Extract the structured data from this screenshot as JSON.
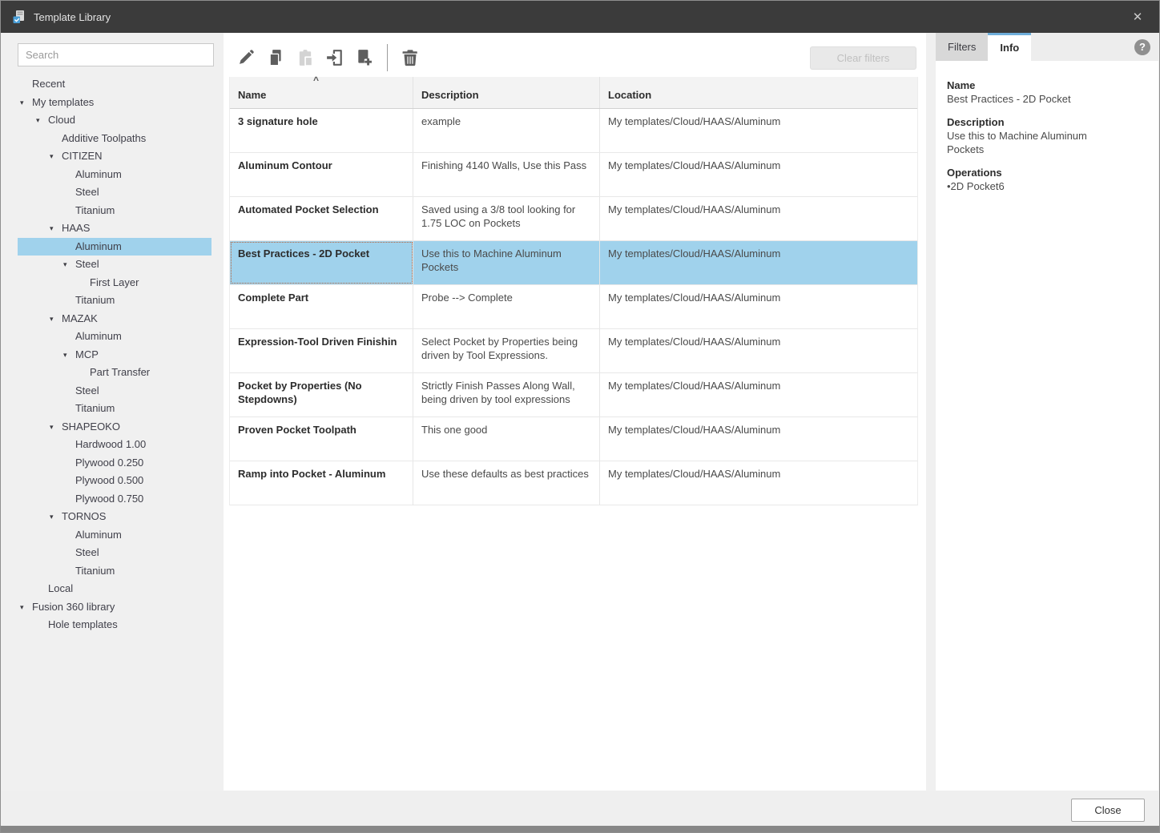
{
  "window": {
    "title": "Template Library"
  },
  "glyphs": {
    "close": "✕",
    "tree_expanded": "▾",
    "sort_asc": "^",
    "help": "?"
  },
  "colors": {
    "titlebar": "#3b3b3b",
    "selection": "#a0d2ec",
    "tab_accent": "#6faedb",
    "focus_dotted": "#b4653f"
  },
  "sidebar": {
    "search_placeholder": "Search",
    "tree": [
      {
        "label": "Recent",
        "level": 0
      },
      {
        "label": "My templates",
        "level": 0,
        "expanded": true
      },
      {
        "label": "Cloud",
        "level": 1,
        "expanded": true
      },
      {
        "label": "Additive Toolpaths",
        "level": 2
      },
      {
        "label": "CITIZEN",
        "level": 2,
        "expanded": true
      },
      {
        "label": "Aluminum",
        "level": 3
      },
      {
        "label": "Steel",
        "level": 3
      },
      {
        "label": "Titanium",
        "level": 3
      },
      {
        "label": "HAAS",
        "level": 2,
        "expanded": true
      },
      {
        "label": "Aluminum",
        "level": 3,
        "selected": true
      },
      {
        "label": "Steel",
        "level": 3,
        "expanded": true
      },
      {
        "label": "First Layer",
        "level": 4
      },
      {
        "label": "Titanium",
        "level": 3
      },
      {
        "label": "MAZAK",
        "level": 2,
        "expanded": true
      },
      {
        "label": "Aluminum",
        "level": 3
      },
      {
        "label": "MCP",
        "level": 3,
        "expanded": true
      },
      {
        "label": "Part Transfer",
        "level": 4
      },
      {
        "label": "Steel",
        "level": 3
      },
      {
        "label": "Titanium",
        "level": 3
      },
      {
        "label": "SHAPEOKO",
        "level": 2,
        "expanded": true
      },
      {
        "label": "Hardwood 1.00",
        "level": 3
      },
      {
        "label": "Plywood 0.250",
        "level": 3
      },
      {
        "label": "Plywood 0.500",
        "level": 3
      },
      {
        "label": "Plywood 0.750",
        "level": 3
      },
      {
        "label": "TORNOS",
        "level": 2,
        "expanded": true
      },
      {
        "label": "Aluminum",
        "level": 3
      },
      {
        "label": "Steel",
        "level": 3
      },
      {
        "label": "Titanium",
        "level": 3
      },
      {
        "label": "Local",
        "level": 1
      },
      {
        "label": "Fusion 360 library",
        "level": 0,
        "expanded": true
      },
      {
        "label": "Hole templates",
        "level": 1
      }
    ]
  },
  "toolbar": {
    "icons": [
      {
        "name": "edit",
        "disabled": false
      },
      {
        "name": "copy",
        "disabled": false
      },
      {
        "name": "paste",
        "disabled": true
      },
      {
        "name": "import",
        "disabled": false
      },
      {
        "name": "export",
        "disabled": false
      },
      {
        "name": "separator"
      },
      {
        "name": "delete",
        "disabled": false
      }
    ],
    "clear_filters_label": "Clear filters"
  },
  "table": {
    "columns": [
      "Name",
      "Description",
      "Location"
    ],
    "rows": [
      {
        "name": "3 signature hole",
        "description": "example",
        "location": "My templates/Cloud/HAAS/Aluminum"
      },
      {
        "name": "Aluminum Contour",
        "description": "Finishing 4140 Walls, Use this Pass",
        "location": "My templates/Cloud/HAAS/Aluminum"
      },
      {
        "name": "Automated Pocket Selection",
        "description": "Saved using a 3/8 tool looking for 1.75 LOC on Pockets",
        "location": "My templates/Cloud/HAAS/Aluminum"
      },
      {
        "name": "Best Practices - 2D Pocket",
        "description": "Use this to Machine Aluminum Pockets",
        "location": "My templates/Cloud/HAAS/Aluminum",
        "selected": true
      },
      {
        "name": "Complete Part",
        "description": "Probe --> Complete",
        "location": "My templates/Cloud/HAAS/Aluminum"
      },
      {
        "name": "Expression-Tool Driven Finishin",
        "description": "Select Pocket by Properties being driven by Tool Expressions.",
        "location": "My templates/Cloud/HAAS/Aluminum"
      },
      {
        "name": "Pocket by Properties (No Stepdowns)",
        "description": "Strictly Finish Passes Along Wall, being driven by tool expressions",
        "location": "My templates/Cloud/HAAS/Aluminum"
      },
      {
        "name": "Proven Pocket Toolpath",
        "description": "This one good",
        "location": "My templates/Cloud/HAAS/Aluminum"
      },
      {
        "name": "Ramp into Pocket - Aluminum",
        "description": "Use these defaults as best practices",
        "location": "My templates/Cloud/HAAS/Aluminum"
      }
    ]
  },
  "info_panel": {
    "tabs": [
      {
        "label": "Filters",
        "active": false
      },
      {
        "label": "Info",
        "active": true
      }
    ],
    "fields": [
      {
        "label": "Name",
        "value": "Best Practices - 2D Pocket"
      },
      {
        "label": "Description",
        "value": "Use this to Machine Aluminum Pockets"
      },
      {
        "label": "Operations",
        "value": "•2D Pocket6"
      }
    ]
  },
  "footer": {
    "close_label": "Close"
  }
}
